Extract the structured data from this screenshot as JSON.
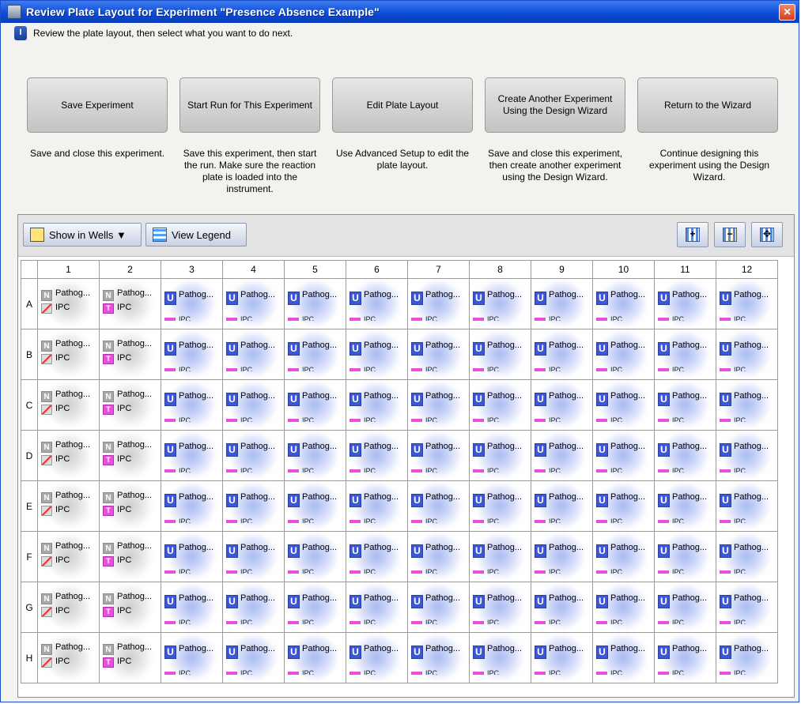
{
  "window": {
    "title": "Review Plate Layout for Experiment \"Presence Absence Example\"",
    "close_glyph": "×"
  },
  "instruction": {
    "icon": "info-icon",
    "text": "Review the plate layout, then select what you want to do next."
  },
  "actions": [
    {
      "label": "Save Experiment",
      "description": "Save and close this experiment."
    },
    {
      "label": "Start Run for This Experiment",
      "description": "Save this experiment, then start the run. Make sure the reaction plate is loaded into the instrument."
    },
    {
      "label": "Edit Plate Layout",
      "description": "Use Advanced Setup to edit the plate layout."
    },
    {
      "label": "Create Another Experiment Using the Design Wizard",
      "description": "Save and close this experiment, then create another experiment using the Design Wizard."
    },
    {
      "label": "Return to the Wizard",
      "description": "Continue designing this experiment using the Design Wizard."
    }
  ],
  "toolbar": {
    "show_in_wells": "Show in Wells ▼",
    "view_legend": "View Legend",
    "zoom_in_icon": "zoom-in-icon",
    "zoom_out_icon": "zoom-out-icon",
    "fit_icon": "fit-to-screen-icon"
  },
  "plate": {
    "columns": [
      "1",
      "2",
      "3",
      "4",
      "5",
      "6",
      "7",
      "8",
      "9",
      "10",
      "11",
      "12"
    ],
    "rows": [
      "A",
      "B",
      "C",
      "D",
      "E",
      "F",
      "G",
      "H"
    ],
    "well_target_text": "Pathog...",
    "well_ipc_text": "IPC",
    "col1_task": "N",
    "col2_task": "N",
    "col2_reporter": "T",
    "unknown_task": "U",
    "ipc_small_text": "IPC",
    "colors": {
      "ntc": "#a9a9a9",
      "unknown": "#3b56d8",
      "ipc_reporter": "#e94ee0"
    }
  }
}
